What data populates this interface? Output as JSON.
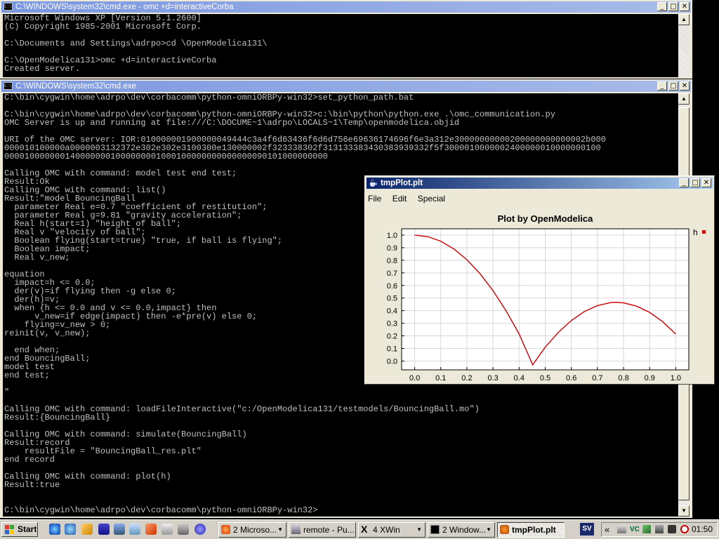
{
  "window1": {
    "title": "C:\\WINDOWS\\system32\\cmd.exe - omc +d=interactiveCorba",
    "lines": [
      "Microsoft Windows XP [Version 5.1.2600]",
      "(C) Copyright 1985-2001 Microsoft Corp.",
      "",
      "C:\\Documents and Settings\\adrpo>cd \\OpenModelica131\\",
      "",
      "C:\\OpenModelica131>omc +d=interactiveCorba",
      "Created server."
    ]
  },
  "window2": {
    "title": "C:\\WINDOWS\\system32\\cmd.exe",
    "lines": [
      "C:\\bin\\cygwin\\home\\adrpo\\dev\\corbacomm\\python-omniORBPy-win32>set_python_path.bat",
      "",
      "C:\\bin\\cygwin\\home\\adrpo\\dev\\corbacomm\\python-omniORBPy-win32>c:\\bin\\python\\python.exe .\\omc_communication.py",
      "OMC Server is up and running at file:///C:\\DOCUME~1\\adrpo\\LOCALS~1\\Temp\\openmodelica.objid",
      "",
      "URI of the OMC server: IOR:010000001900000049444c3a4f6d63436f6d6d756e69636174696f6e3a312e30000000000200000000000002b000",
      "000010100000a0000003132372e302e302e3100300e130000002f323338302f313133383430383939332f5f3000010000002400000010000000100",
      "0000100000001400000001000000001000100000000000000090101000000000",
      "",
      "Calling OMC with command: model test end test;",
      "Result:Ok",
      "Calling OMC with command: list()",
      "Result:\"model BouncingBall",
      "  parameter Real e=0.7 \"coefficient of restitution\";",
      "  parameter Real g=9.81 \"gravity acceleration\";",
      "  Real h(start=1) \"height of ball\";",
      "  Real v \"velocity of ball\";",
      "  Boolean flying(start=true) \"true, if ball is flying\";",
      "  Boolean impact;",
      "  Real v_new;",
      "",
      "equation",
      "  impact=h <= 0.0;",
      "  der(v)=if flying then -g else 0;",
      "  der(h)=v;",
      "  when {h <= 0.0 and v <= 0.0,impact} then",
      "      v_new=if edge(impact) then -e*pre(v) else 0;",
      "    flying=v_new > 0;",
      "reinit(v, v_new);",
      "",
      "  end when;",
      "end BouncingBall;",
      "model test",
      "end test;",
      "",
      "\"",
      "",
      "Calling OMC with command: loadFileInteractive(\"c:/OpenModelica131/testmodels/BouncingBall.mo\")",
      "Result:{BouncingBall}",
      "",
      "Calling OMC with command: simulate(BouncingBall)",
      "Result:record",
      "    resultFile = \"BouncingBall_res.plt\"",
      "end record",
      "",
      "Calling OMC with command: plot(h)",
      "Result:true",
      "",
      "",
      "C:\\bin\\cygwin\\home\\adrpo\\dev\\corbacomm\\python-omniORBPy-win32>"
    ]
  },
  "plot_window": {
    "title": "tmpPlot.plt",
    "menu": [
      "File",
      "Edit",
      "Special"
    ]
  },
  "chart_data": {
    "type": "line",
    "title": "Plot by OpenModelica",
    "xlim": [
      -0.05,
      1.05
    ],
    "ylim": [
      -0.07,
      1.05
    ],
    "xticks": [
      0.0,
      0.1,
      0.2,
      0.3,
      0.4,
      0.5,
      0.6,
      0.7,
      0.8,
      0.9,
      1.0
    ],
    "yticks": [
      0.0,
      0.1,
      0.2,
      0.3,
      0.4,
      0.5,
      0.6,
      0.7,
      0.8,
      0.9,
      1.0
    ],
    "grid": true,
    "legend_position": "right",
    "series": [
      {
        "name": "h",
        "color": "#cc0000",
        "x": [
          0.0,
          0.05,
          0.1,
          0.15,
          0.2,
          0.25,
          0.3,
          0.35,
          0.4,
          0.452,
          0.5,
          0.55,
          0.6,
          0.65,
          0.7,
          0.75,
          0.77,
          0.8,
          0.85,
          0.9,
          0.95,
          1.0
        ],
        "y": [
          1.0,
          0.988,
          0.951,
          0.89,
          0.804,
          0.694,
          0.559,
          0.399,
          0.215,
          -0.03,
          0.11,
          0.227,
          0.322,
          0.393,
          0.44,
          0.464,
          0.467,
          0.462,
          0.436,
          0.386,
          0.312,
          0.214
        ]
      }
    ]
  },
  "taskbar": {
    "start_label": "Start",
    "tasks": [
      {
        "label": "2 Microso...",
        "dropdown": true
      },
      {
        "label": "remote - Pu...",
        "dropdown": false
      },
      {
        "label": "4 XWin",
        "dropdown": true
      },
      {
        "label": "2 Window...",
        "dropdown": true
      },
      {
        "label": "tmpPlot.plt",
        "dropdown": false
      }
    ],
    "tray_sv": "SV",
    "tray_vc": "VC",
    "chevron": "«",
    "clock": "01:50"
  }
}
